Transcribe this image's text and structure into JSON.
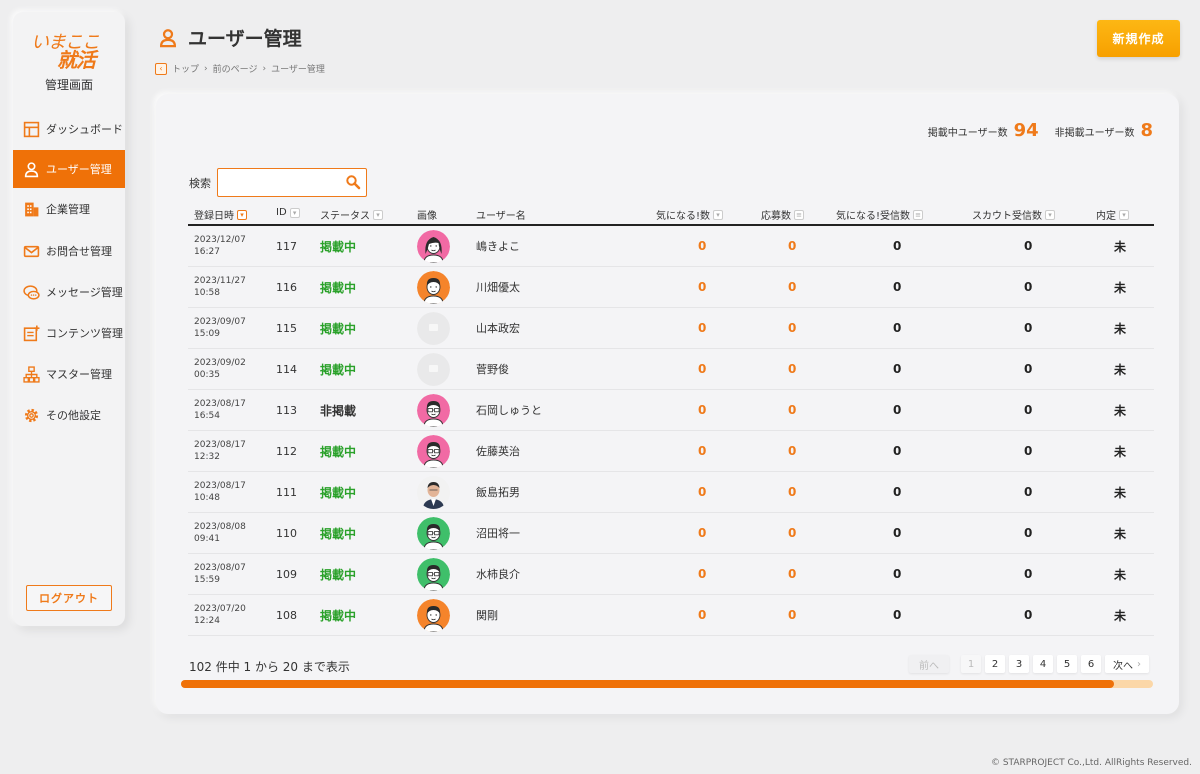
{
  "sidebar": {
    "logo_line1": "いまここ",
    "logo_line2": "就活",
    "subtitle": "管理画面",
    "items": [
      {
        "label": "ダッシュボード",
        "icon": "dashboard-icon"
      },
      {
        "label": "ユーザー管理",
        "icon": "user-icon"
      },
      {
        "label": "企業管理",
        "icon": "building-icon"
      },
      {
        "label": "お問合せ管理",
        "icon": "mail-icon"
      },
      {
        "label": "メッセージ管理",
        "icon": "chat-icon"
      },
      {
        "label": "コンテンツ管理",
        "icon": "content-icon"
      },
      {
        "label": "マスター管理",
        "icon": "hierarchy-icon"
      },
      {
        "label": "その他設定",
        "icon": "gear-icon"
      }
    ],
    "logout": "ログアウト"
  },
  "header": {
    "title": "ユーザー管理",
    "breadcrumb": [
      "トップ",
      "前のページ",
      "ユーザー管理"
    ],
    "new_button": "新規作成"
  },
  "stats": {
    "active_label": "掲載中ユーザー数",
    "active_value": "94",
    "inactive_label": "非掲載ユーザー数",
    "inactive_value": "8"
  },
  "search": {
    "label": "検索",
    "value": ""
  },
  "table": {
    "columns": [
      "登録日時",
      "ID",
      "ステータス",
      "画像",
      "ユーザー名",
      "気になる!数",
      "応募数",
      "気になる!受信数",
      "スカウト受信数",
      "内定"
    ],
    "rows": [
      {
        "date": "2023/12/07",
        "time": "16:27",
        "id": "117",
        "status": "掲載中",
        "avatar": "woman-pink",
        "name": "嶋きよこ",
        "likes": "0",
        "applications": "0",
        "likes_received": "0",
        "scouts": "0",
        "offer": "未"
      },
      {
        "date": "2023/11/27",
        "time": "10:58",
        "id": "116",
        "status": "掲載中",
        "avatar": "man-orange",
        "name": "川畑優太",
        "likes": "0",
        "applications": "0",
        "likes_received": "0",
        "scouts": "0",
        "offer": "未"
      },
      {
        "date": "2023/09/07",
        "time": "15:09",
        "id": "115",
        "status": "掲載中",
        "avatar": "placeholder",
        "name": "山本政宏",
        "likes": "0",
        "applications": "0",
        "likes_received": "0",
        "scouts": "0",
        "offer": "未"
      },
      {
        "date": "2023/09/02",
        "time": "00:35",
        "id": "114",
        "status": "掲載中",
        "avatar": "placeholder",
        "name": "菅野俊",
        "likes": "0",
        "applications": "0",
        "likes_received": "0",
        "scouts": "0",
        "offer": "未"
      },
      {
        "date": "2023/08/17",
        "time": "16:54",
        "id": "113",
        "status": "非掲載",
        "avatar": "man-pink",
        "name": "石岡しゅうと",
        "likes": "0",
        "applications": "0",
        "likes_received": "0",
        "scouts": "0",
        "offer": "未"
      },
      {
        "date": "2023/08/17",
        "time": "12:32",
        "id": "112",
        "status": "掲載中",
        "avatar": "man-pink",
        "name": "佐藤英治",
        "likes": "0",
        "applications": "0",
        "likes_received": "0",
        "scouts": "0",
        "offer": "未"
      },
      {
        "date": "2023/08/17",
        "time": "10:48",
        "id": "111",
        "status": "掲載中",
        "avatar": "photo",
        "name": "飯島拓男",
        "likes": "0",
        "applications": "0",
        "likes_received": "0",
        "scouts": "0",
        "offer": "未"
      },
      {
        "date": "2023/08/08",
        "time": "09:41",
        "id": "110",
        "status": "掲載中",
        "avatar": "man-green",
        "name": "沼田将一",
        "likes": "0",
        "applications": "0",
        "likes_received": "0",
        "scouts": "0",
        "offer": "未"
      },
      {
        "date": "2023/08/07",
        "time": "15:59",
        "id": "109",
        "status": "掲載中",
        "avatar": "man-green",
        "name": "水柿良介",
        "likes": "0",
        "applications": "0",
        "likes_received": "0",
        "scouts": "0",
        "offer": "未"
      },
      {
        "date": "2023/07/20",
        "time": "12:24",
        "id": "108",
        "status": "掲載中",
        "avatar": "man-orange",
        "name": "関剛",
        "likes": "0",
        "applications": "0",
        "likes_received": "0",
        "scouts": "0",
        "offer": "未"
      }
    ]
  },
  "pagination": {
    "info": "102 件中 1 から 20 まで表示",
    "prev": "前へ",
    "pages": [
      "1",
      "2",
      "3",
      "4",
      "5",
      "6"
    ],
    "current": "1",
    "next": "次へ"
  },
  "scroll_position": 0.96,
  "colors": {
    "accent": "#ef7108",
    "status_active": "#2aa12a",
    "button": "#fdb714"
  },
  "copyright": "© STARPROJECT Co.,Ltd. AllRights Reserved."
}
